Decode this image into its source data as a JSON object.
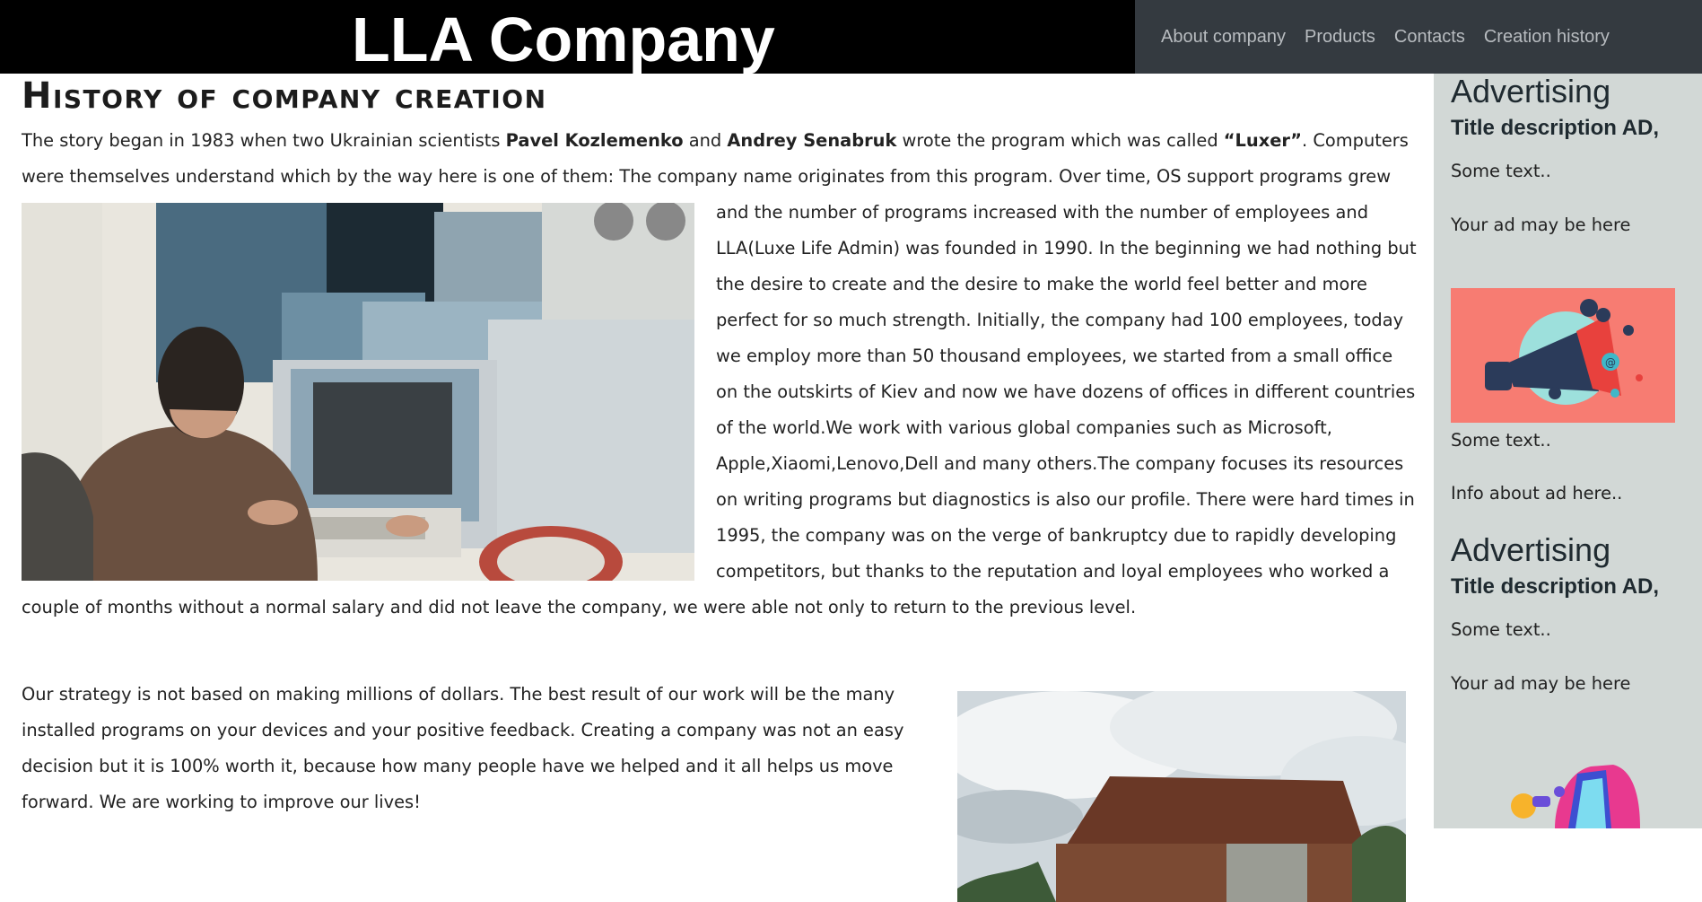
{
  "header": {
    "brand": "LLA Company",
    "nav": [
      "About company",
      "Products",
      "Contacts",
      "Creation history"
    ]
  },
  "main": {
    "title": "History of company creation",
    "p1": {
      "t1": "The story began in 1983 when two Ukrainian scientists ",
      "name1": "Pavel Kozlemenko",
      "t2": " and ",
      "name2": "Andrey Senabruk",
      "t3": " wrote the program which was called ",
      "program": "“Luxer”",
      "t4": ". Computers were themselves understand which by the way here is one of them: The company name originates from this program. Over time, OS support programs grew and the number of programs increased with the number of employees and LLA(Luxe Life Admin) was founded in 1990. In the beginning we had nothing but the desire to create and the desire to make the world feel better and more perfect for so much strength. Initially, the company had 100 employees, today we employ more than 50 thousand employees, we started from a small office on the outskirts of Kiev and now we have dozens of offices in different countries of the world.We work with various global companies such as Microsoft, Apple,Xiaomi,Lenovo,Dell and many others.The company focuses its resources on writing programs but diagnostics is also our profile. There were hard times in 1995, the company was on the verge of bankruptcy due to rapidly developing competitors, but thanks to the reputation and loyal employees who worked a couple of months without a normal salary and did not leave the company, we were able not only to return to the previous level."
    },
    "p2": "Our strategy is not based on making millions of dollars. The best result of our work will be the many installed programs on your devices and your positive feedback. Creating a company was not an easy decision but it is 100% worth it, because how many people have we helped and it all helps us move forward. We are working to improve our lives!"
  },
  "sidebar": {
    "ad1": {
      "title": "Advertising",
      "subtitle": "Title description AD,",
      "text1": "Some text..",
      "text2": "Your ad may be here",
      "text3": "Some text..",
      "text4": "Info about ad here.."
    },
    "ad2": {
      "title": "Advertising",
      "subtitle": "Title description AD,",
      "text1": "Some text..",
      "text2": "Your ad may be here"
    }
  },
  "colors": {
    "header_bg": "#000000",
    "nav_bg": "#343a40",
    "sidebar_bg": "#d2d8d6",
    "ad_image_bg": "#f77c72"
  }
}
